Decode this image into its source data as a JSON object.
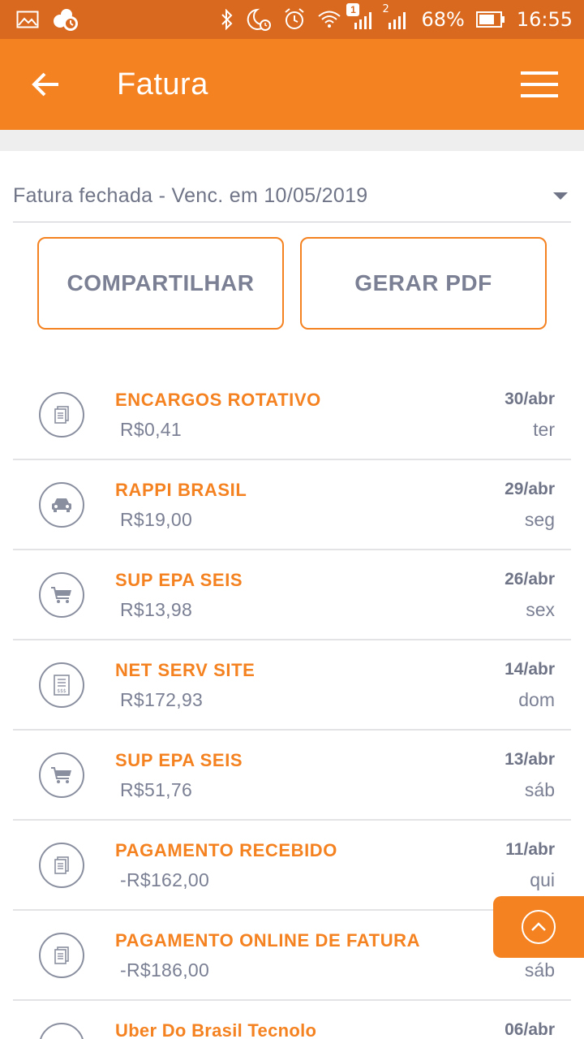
{
  "status_bar": {
    "battery": "68%",
    "time": "16:55",
    "sim1_badge": "1",
    "sim2_label": "2",
    "icons": [
      "image-icon",
      "weather-icon",
      "bluetooth-icon",
      "do-not-disturb-icon",
      "alarm-icon",
      "wifi-icon",
      "signal-icon",
      "battery-icon"
    ]
  },
  "app_bar": {
    "title": "Fatura"
  },
  "invoice_selector": {
    "value": "Fatura fechada - Venc. em 10/05/2019"
  },
  "actions": {
    "share_label": "COMPARTILHAR",
    "pdf_label": "GERAR PDF"
  },
  "transactions": [
    {
      "merchant": "ENCARGOS ROTATIVO",
      "amount": "R$0,41",
      "date": "30/abr",
      "weekday": "ter",
      "icon": "document-icon"
    },
    {
      "merchant": "RAPPI BRASIL",
      "amount": "R$19,00",
      "date": "29/abr",
      "weekday": "seg",
      "icon": "car-icon"
    },
    {
      "merchant": "SUP EPA SEIS",
      "amount": "R$13,98",
      "date": "26/abr",
      "weekday": "sex",
      "icon": "cart-icon"
    },
    {
      "merchant": "NET SERV SITE",
      "amount": "R$172,93",
      "date": "14/abr",
      "weekday": "dom",
      "icon": "bill-icon"
    },
    {
      "merchant": "SUP EPA SEIS",
      "amount": "R$51,76",
      "date": "13/abr",
      "weekday": "sáb",
      "icon": "cart-icon"
    },
    {
      "merchant": "PAGAMENTO RECEBIDO",
      "amount": "-R$162,00",
      "date": "11/abr",
      "weekday": "qui",
      "icon": "document-icon"
    },
    {
      "merchant": "PAGAMENTO ONLINE DE FATURA",
      "amount": "-R$186,00",
      "date": "",
      "weekday": "sáb",
      "icon": "document-icon"
    },
    {
      "merchant": "Uber Do Brasil Tecnolo",
      "amount": "",
      "date": "06/abr",
      "weekday": "",
      "icon": "car-icon"
    }
  ],
  "colors": {
    "brand_orange": "#f58220",
    "status_bar": "#d9691f",
    "text_gray": "#7b8094"
  }
}
